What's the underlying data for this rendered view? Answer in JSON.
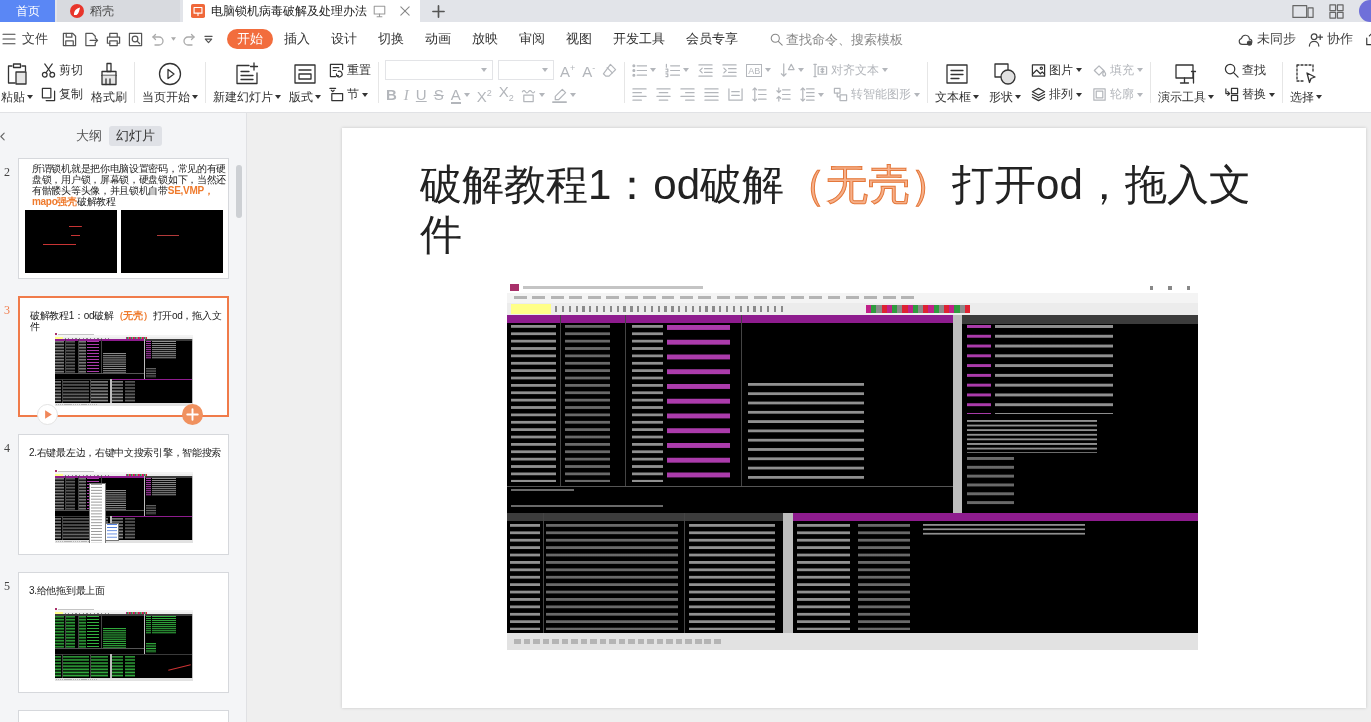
{
  "tabs": [
    {
      "label": "首页",
      "kind": "home",
      "selected": false
    },
    {
      "label": "稻壳",
      "kind": "docer",
      "selected": false
    },
    {
      "label": "电脑锁机病毒破解及处理办法",
      "kind": "presentation",
      "selected": true
    }
  ],
  "menu_bar": {
    "file": "文件",
    "tabs": [
      {
        "label": "开始",
        "selected": true
      },
      {
        "label": "插入",
        "selected": false
      },
      {
        "label": "设计",
        "selected": false
      },
      {
        "label": "切换",
        "selected": false
      },
      {
        "label": "动画",
        "selected": false
      },
      {
        "label": "放映",
        "selected": false
      },
      {
        "label": "审阅",
        "selected": false
      },
      {
        "label": "视图",
        "selected": false
      },
      {
        "label": "开发工具",
        "selected": false
      },
      {
        "label": "会员专享",
        "selected": false
      }
    ],
    "search": {
      "placeholder": "查找命令、搜索模板"
    },
    "sync": "未同步",
    "collaborate": "协作"
  },
  "ribbon": {
    "groups": [
      {
        "kind": "clipboard",
        "columns": [
          [
            {
              "kind": "large",
              "label": "粘贴",
              "dropdown": true,
              "disabled": false
            }
          ],
          [
            {
              "kind": "small",
              "label": "剪切",
              "dropdown": false,
              "disabled": false
            },
            {
              "kind": "small",
              "label": "复制",
              "dropdown": false,
              "disabled": false
            }
          ],
          [
            {
              "kind": "large",
              "label": "格式刷",
              "dropdown": false,
              "disabled": false
            }
          ]
        ]
      },
      {
        "kind": "play",
        "columns": [
          [
            {
              "kind": "large",
              "label": "当页开始",
              "dropdown": true,
              "disabled": false
            }
          ]
        ]
      },
      {
        "kind": "slides",
        "columns": [
          [
            {
              "kind": "large",
              "label": "新建幻灯片",
              "dropdown": true,
              "disabled": false
            }
          ],
          [
            {
              "kind": "large",
              "label": "版式",
              "dropdown": true,
              "disabled": false
            }
          ],
          [
            {
              "kind": "small",
              "label": "重置",
              "dropdown": false,
              "disabled": false
            },
            {
              "kind": "small",
              "label": "节",
              "dropdown": true,
              "disabled": false
            }
          ]
        ]
      },
      {
        "kind": "font",
        "rows": [
          [
            {
              "kind": "field",
              "dropdown": true,
              "disabled": true
            },
            {
              "kind": "field",
              "dropdown": true,
              "disabled": true
            },
            {
              "kind": "glyph",
              "glyph": "A$^{+}$",
              "dropdown": false,
              "disabled": true
            },
            {
              "kind": "glyph",
              "glyph": "A$^{-}$",
              "dropdown": false,
              "disabled": true
            },
            {
              "kind": "icon",
              "dropdown": false,
              "disabled": true
            }
          ],
          [
            {
              "kind": "glyph",
              "glyph": "B",
              "dropdown": false,
              "disabled": true
            },
            {
              "kind": "glyph",
              "glyph": "I",
              "dropdown": false,
              "disabled": true
            },
            {
              "kind": "glyph",
              "glyph": "U",
              "dropdown": false,
              "disabled": true
            },
            {
              "kind": "glyph",
              "glyph": "S",
              "dropdown": false,
              "disabled": true
            },
            {
              "kind": "glyph",
              "glyph": "A",
              "dropdown": true,
              "disabled": true
            },
            {
              "kind": "glyph",
              "glyph": "X$^{2}$",
              "dropdown": false,
              "disabled": true
            },
            {
              "kind": "glyph",
              "glyph": "X$_{2}$",
              "dropdown": false,
              "disabled": true
            },
            {
              "kind": "icon",
              "dropdown": true,
              "disabled": true
            },
            {
              "kind": "icon",
              "dropdown": true,
              "disabled": true
            }
          ]
        ]
      },
      {
        "kind": "paragraph",
        "rows": [
          [
            {
              "kind": "icon",
              "dropdown": true,
              "disabled": true
            },
            {
              "kind": "icon",
              "dropdown": true,
              "disabled": true
            },
            {
              "kind": "icon",
              "dropdown": false,
              "disabled": true
            },
            {
              "kind": "icon",
              "dropdown": false,
              "disabled": true
            },
            {
              "kind": "glyph",
              "glyph": "AB",
              "dropdown": true,
              "disabled": true
            },
            {
              "kind": "icon",
              "dropdown": true,
              "disabled": true
            },
            {
              "kind": "small",
              "label": "对齐文本",
              "dropdown": true,
              "disabled": true
            }
          ],
          [
            {
              "kind": "icon",
              "dropdown": false,
              "disabled": true
            },
            {
              "kind": "icon",
              "dropdown": false,
              "disabled": true
            },
            {
              "kind": "icon",
              "dropdown": false,
              "disabled": true
            },
            {
              "kind": "icon",
              "dropdown": false,
              "disabled": true
            },
            {
              "kind": "icon",
              "dropdown": false,
              "disabled": true
            },
            {
              "kind": "icon",
              "dropdown": false,
              "disabled": true
            },
            {
              "kind": "icon",
              "dropdown": false,
              "disabled": true
            },
            {
              "kind": "icon",
              "dropdown": true,
              "disabled": true
            },
            {
              "kind": "small",
              "label": "转智能图形",
              "dropdown": true,
              "disabled": true
            }
          ]
        ]
      },
      {
        "kind": "insert",
        "columns": [
          [
            {
              "kind": "large",
              "label": "文本框",
              "dropdown": true,
              "disabled": false
            }
          ],
          [
            {
              "kind": "large",
              "label": "形状",
              "dropdown": true,
              "disabled": false
            }
          ],
          [
            {
              "kind": "small",
              "label": "图片",
              "dropdown": true,
              "disabled": false
            },
            {
              "kind": "small",
              "label": "排列",
              "dropdown": true,
              "disabled": false
            }
          ],
          [
            {
              "kind": "small",
              "label": "填充",
              "dropdown": true,
              "disabled": true
            },
            {
              "kind": "small",
              "label": "轮廓",
              "dropdown": true,
              "disabled": true
            }
          ]
        ]
      },
      {
        "kind": "tools",
        "columns": [
          [
            {
              "kind": "large",
              "label": "演示工具",
              "dropdown": true,
              "disabled": false
            }
          ],
          [
            {
              "kind": "small",
              "label": "查找",
              "dropdown": false,
              "disabled": false
            },
            {
              "kind": "small",
              "label": "替换",
              "dropdown": true,
              "disabled": false
            }
          ]
        ]
      },
      {
        "kind": "select",
        "columns": [
          [
            {
              "kind": "large",
              "label": "选择",
              "dropdown": true,
              "disabled": false
            }
          ]
        ]
      }
    ]
  },
  "sidebar": {
    "view_tabs": [
      {
        "label": "大纲",
        "selected": false
      },
      {
        "label": "幻灯片",
        "selected": true
      }
    ],
    "slides": [
      {
        "number": "2",
        "selected": false,
        "kind": "two-images",
        "title": [
          {
            "text": "所谓锁机就是把你电脑设置密码，常见的有硬盘锁，用户锁，屏幕锁，硬盘锁如下，当然还有骷髅头等头像，并且锁机自带",
            "highlight": false
          },
          {
            "text": "SE,VMP，mapo强壳",
            "highlight": true
          },
          {
            "text": "破解教程",
            "highlight": false
          }
        ]
      },
      {
        "number": "3",
        "selected": true,
        "kind": "debugger",
        "title": [
          {
            "text": "破解教程1：od破解",
            "highlight": false
          },
          {
            "text": "（无壳）",
            "highlight": true
          },
          {
            "text": "打开od，拖入文件",
            "highlight": false
          }
        ]
      },
      {
        "number": "4",
        "selected": false,
        "kind": "debugger-menu",
        "title": [
          {
            "text": "2.右键最左边，右键中文搜索引擎，智能搜索",
            "highlight": false
          }
        ]
      },
      {
        "number": "5",
        "selected": false,
        "kind": "debugger-green",
        "title": [
          {
            "text": "3.给他拖到最上面",
            "highlight": false
          }
        ]
      },
      {
        "selected": false,
        "kind": "blank"
      }
    ]
  },
  "slide": {
    "kind": "debugger",
    "title": [
      {
        "text": "破解教程1：od破解",
        "highlight": false
      },
      {
        "text": "（无壳）",
        "highlight": true
      },
      {
        "text": "打开od，拖入文件",
        "highlight": false
      }
    ]
  }
}
